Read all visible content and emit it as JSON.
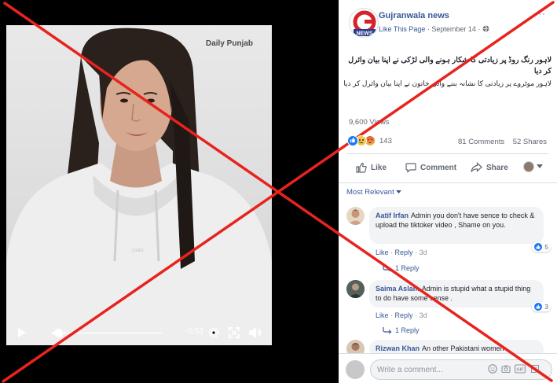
{
  "video": {
    "watermark": "Daily Punjab",
    "time_remaining": "-0:53",
    "progress_fraction": 0.06
  },
  "post": {
    "page_name": "Gujranwala news",
    "logo_text": "NEWS",
    "like_page": "Like This Page",
    "date": "September 14",
    "title_ur": "لاہور رنگ روڈ پر زیادتی کا شکار ہونے والی لڑکی نے اپنا بیان وائرل کر دیا",
    "body_ur": "لاہور موٹروے پر زیادتی کا نشانہ بننے والی خاتون نے اپنا بیان وائرل کر دیا",
    "views": "9,600 Views",
    "reaction_count": "143",
    "comments_count": "81 Comments",
    "shares_count": "52 Shares"
  },
  "actions": {
    "like": "Like",
    "comment": "Comment",
    "share": "Share"
  },
  "sort_label": "Most Relevant",
  "comments": [
    {
      "author": "Aatif Irfan",
      "text": "Admin you don't have sence to check & upload the tiktoker video , Shame on you.",
      "like": "Like",
      "reply": "Reply",
      "time": "3d",
      "reactions": "5",
      "replies": "1 Reply"
    },
    {
      "author": "Saima Aslam",
      "text": "Admin is stupid what a stupid thing to do have some sense .",
      "like": "Like",
      "reply": "Reply",
      "time": "3d",
      "reactions": "3",
      "replies": "1 Reply"
    },
    {
      "author": "Rizwan Khan",
      "text": "An other Pakistani women"
    }
  ],
  "composer": {
    "placeholder": "Write a comment..."
  },
  "colors": {
    "fb_blue": "#385898",
    "cross_red": "#e8231e"
  }
}
